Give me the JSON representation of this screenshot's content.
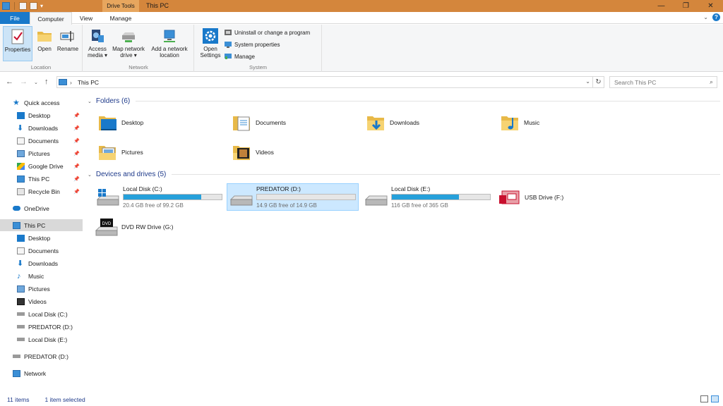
{
  "window": {
    "title": "This PC",
    "contextual_tab": "Drive Tools"
  },
  "tabs": [
    "File",
    "Computer",
    "View",
    "Manage"
  ],
  "ribbon": {
    "location_group": {
      "label": "Location",
      "properties": "Properties",
      "open": "Open",
      "rename": "Rename"
    },
    "network_group": {
      "label": "Network",
      "access_media_1": "Access",
      "access_media_2": "media",
      "map_drive_1": "Map network",
      "map_drive_2": "drive",
      "add_location_1": "Add a network",
      "add_location_2": "location"
    },
    "system_group": {
      "label": "System",
      "open_settings_1": "Open",
      "open_settings_2": "Settings",
      "uninstall": "Uninstall or change a program",
      "system_properties": "System properties",
      "manage": "Manage"
    }
  },
  "address": {
    "path": "This PC",
    "search_placeholder": "Search This PC"
  },
  "nav": {
    "quick_access": "Quick access",
    "quick_items": [
      "Desktop",
      "Downloads",
      "Documents",
      "Pictures",
      "Google Drive",
      "This PC",
      "Recycle Bin"
    ],
    "onedrive": "OneDrive",
    "this_pc": "This PC",
    "pc_items": [
      "Desktop",
      "Documents",
      "Downloads",
      "Music",
      "Pictures",
      "Videos",
      "Local Disk (C:)",
      "PREDATOR (D:)",
      "Local Disk (E:)"
    ],
    "predator": "PREDATOR (D:)",
    "network": "Network"
  },
  "folders_header": "Folders (6)",
  "folders": [
    "Desktop",
    "Documents",
    "Downloads",
    "Music",
    "Pictures",
    "Videos"
  ],
  "devices_header": "Devices and drives (5)",
  "drives": [
    {
      "name": "Local Disk (C:)",
      "free": "20.4 GB free of 99.2 GB",
      "used_fraction": 0.79
    },
    {
      "name": "PREDATOR (D:)",
      "free": "14.9 GB free of 14.9 GB",
      "used_fraction": 0.0
    },
    {
      "name": "Local Disk (E:)",
      "free": "116 GB free of 365 GB",
      "used_fraction": 0.68
    },
    {
      "name": "USB Drive (F:)"
    },
    {
      "name": "DVD RW Drive (G:)"
    }
  ],
  "status": {
    "items": "11 items",
    "selected": "1 item selected"
  },
  "colors": {
    "title_bar": "#d4863c",
    "file_tab": "#1979ca",
    "selection": "#cce8ff",
    "drive_bar": "#26a0da",
    "group_header": "#1e3a8a"
  }
}
